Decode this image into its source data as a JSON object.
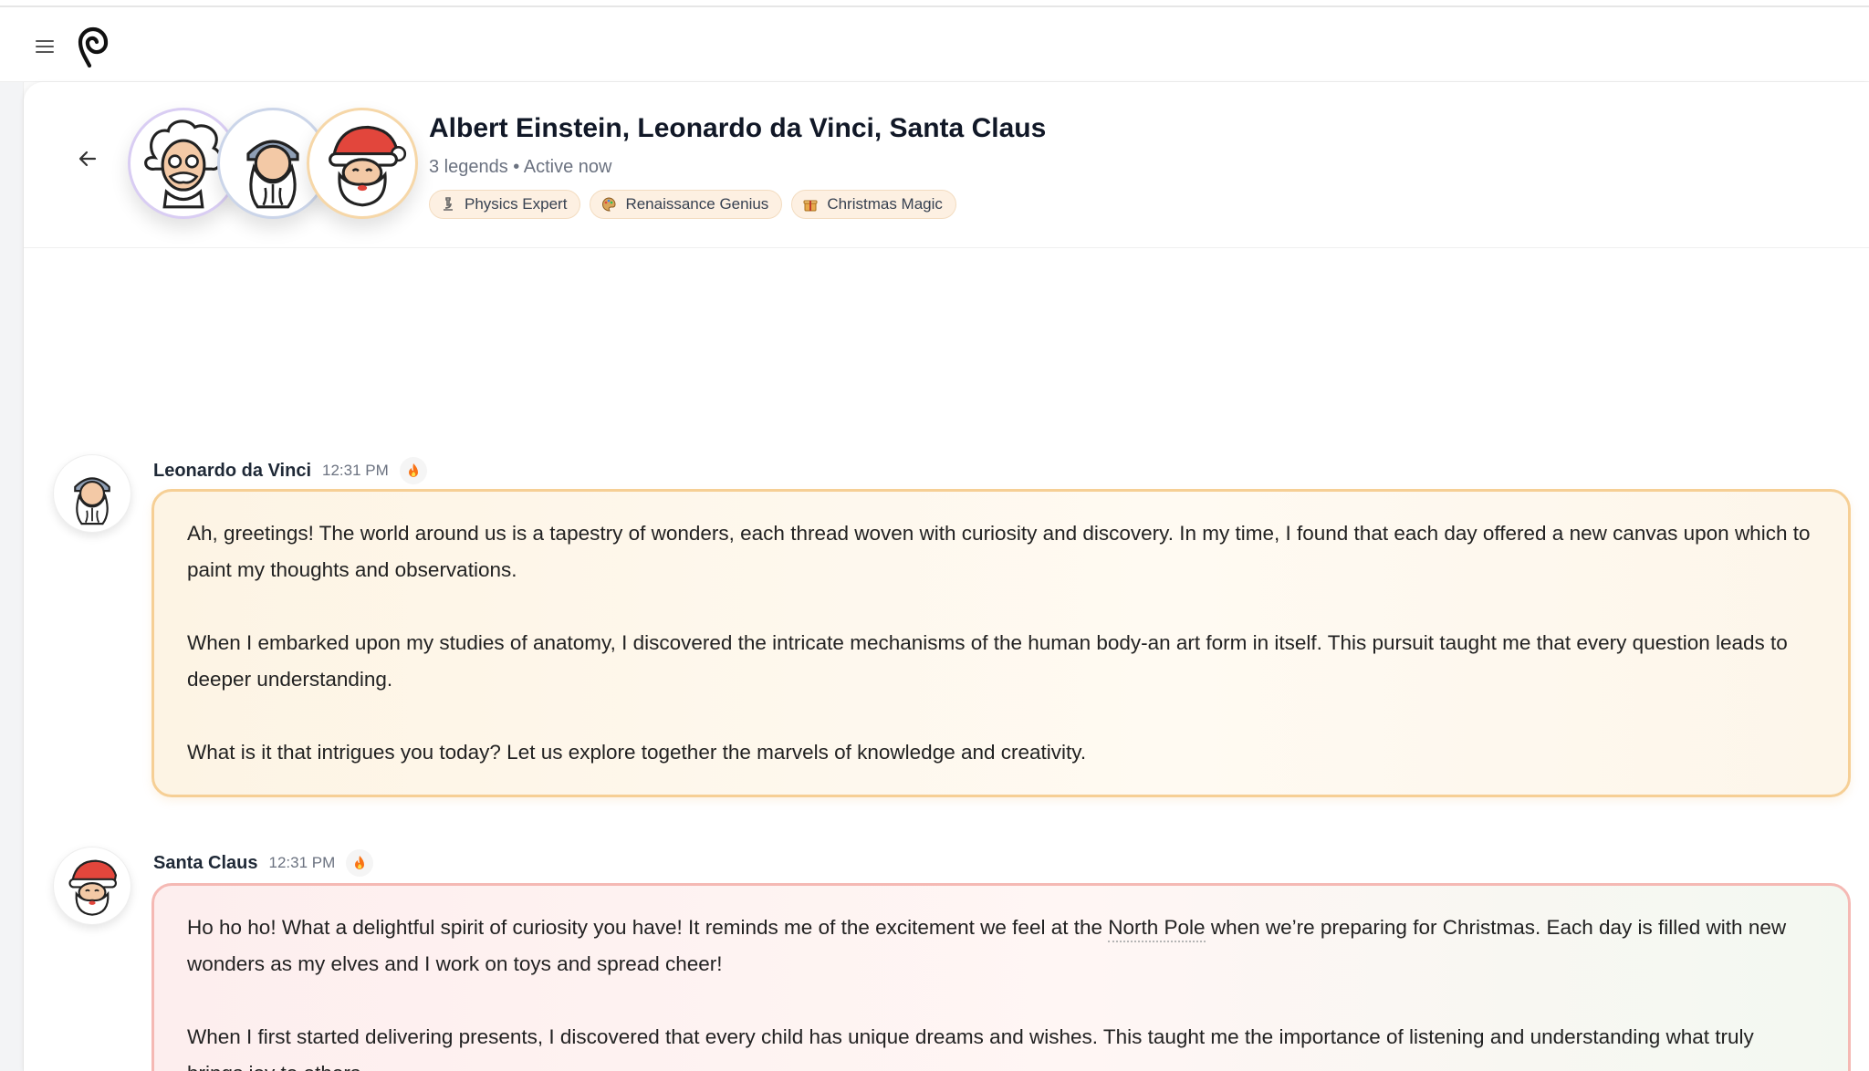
{
  "header": {
    "title": "Albert Einstein, Leonardo da Vinci, Santa Claus",
    "subtitle": "3 legends • Active now",
    "chips": [
      {
        "icon": "microscope-icon",
        "label": "Physics Expert"
      },
      {
        "icon": "palette-icon",
        "label": "Renaissance Genius"
      },
      {
        "icon": "present-icon",
        "label": "Christmas Magic"
      }
    ]
  },
  "messages": [
    {
      "sender": "Leonardo da Vinci",
      "time": "12:31 PM",
      "reaction_icon": "fire-icon",
      "paragraphs": [
        "Ah, greetings! The world around us is a tapestry of wonders, each thread woven with curiosity and discovery. In my time, I found that each day offered a new canvas upon which to paint my thoughts and observations.",
        "When I embarked upon my studies of anatomy, I discovered the intricate mechanisms of the human body-an art form in itself. This pursuit taught me that every question leads to deeper understanding.",
        "What is it that intrigues you today? Let us explore together the marvels of knowledge and creativity."
      ]
    },
    {
      "sender": "Santa Claus",
      "time": "12:31 PM",
      "reaction_icon": "fire-icon",
      "p1_before": "Ho ho ho! What a delightful spirit of curiosity you have! It reminds me of the excitement we feel at the ",
      "p1_link": "North Pole",
      "p1_after": " when we’re preparing for Christmas. Each day is filled with new wonders as my elves and I work on toys and spread cheer!",
      "p2": "When I first started delivering presents, I discovered that every child has unique dreams and wishes. This taught me the importance of listening and understanding what truly brings joy to others."
    }
  ],
  "colors": {
    "leonardo_border": "#f6cf95",
    "santa_border": "#f5b9b4"
  }
}
